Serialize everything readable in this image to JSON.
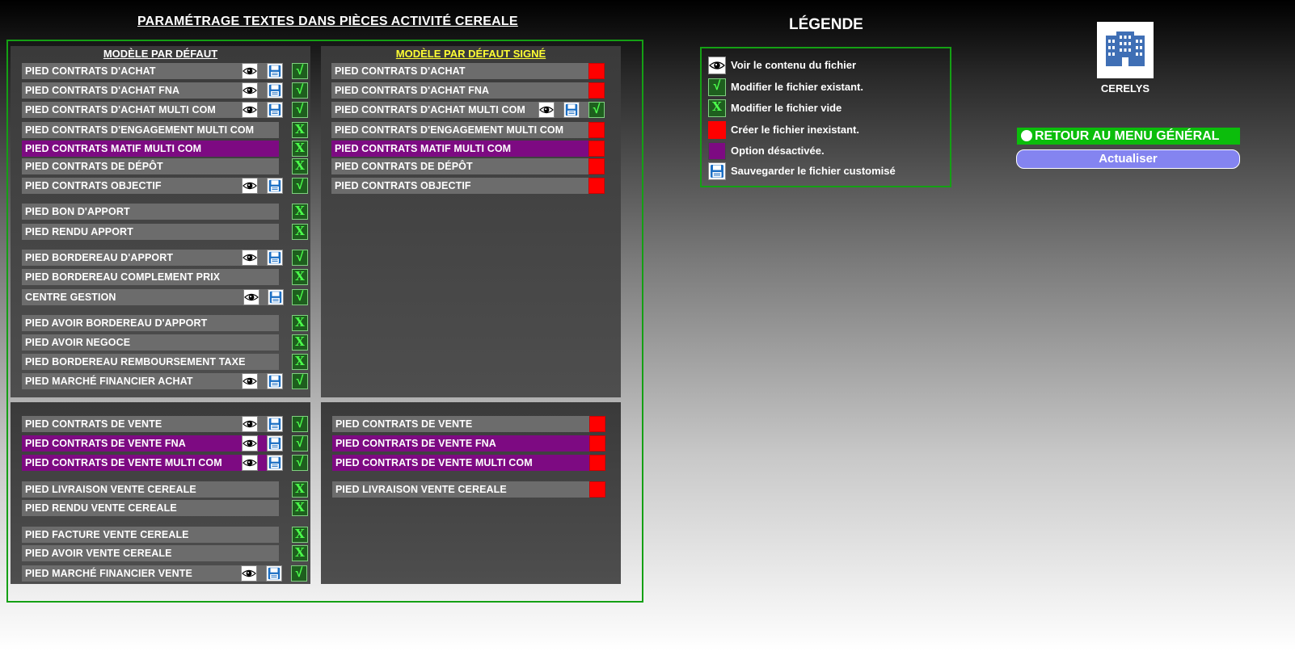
{
  "page_title": "PARAMÉTRAGE TEXTES DANS PIÈCES ACTIVITÉ CEREALE",
  "panels": {
    "default_title": "MODÈLE PAR DÉFAUT",
    "signed_title": "MODÈLE PAR DÉFAUT SIGNÉ"
  },
  "rows": {
    "r1": "PIED CONTRATS D'ACHAT",
    "r2": "PIED CONTRATS D'ACHAT FNA",
    "r3": "PIED CONTRATS D'ACHAT MULTI COM",
    "r4": "PIED CONTRATS D'ENGAGEMENT MULTI COM",
    "r5": "PIED CONTRATS MATIF MULTI COM",
    "r6": "PIED CONTRATS DE DÉPÔT",
    "r7": "PIED CONTRATS OBJECTIF",
    "r8": "PIED BON D'APPORT",
    "r9": "PIED RENDU APPORT",
    "r10": "PIED BORDEREAU D'APPORT",
    "r11": "PIED BORDEREAU COMPLEMENT PRIX",
    "r12": "CENTRE GESTION",
    "r13": "PIED AVOIR BORDEREAU D'APPORT",
    "r14": "PIED AVOIR NEGOCE",
    "r15": "PIED BORDEREAU REMBOURSEMENT TAXE",
    "r16": "PIED MARCHÉ FINANCIER ACHAT",
    "v1": "PIED CONTRATS DE VENTE",
    "v2": "PIED CONTRATS DE VENTE FNA",
    "v3": "PIED CONTRATS DE VENTE MULTI COM",
    "v4": "PIED LIVRAISON VENTE CEREALE",
    "v5": "PIED RENDU VENTE CEREALE",
    "v6": "PIED FACTURE VENTE CEREALE",
    "v7": "PIED AVOIR VENTE CEREALE",
    "v8": "PIED MARCHÉ FINANCIER VENTE"
  },
  "glyphs": {
    "check": "√",
    "x": "X"
  },
  "legend": {
    "title": "LÉGENDE",
    "view": "Voir le contenu du fichier",
    "modify_existing": "Modifier le fichier existant.",
    "modify_empty": "Modifier le fichier vide",
    "create": "Créer le fichier inexistant.",
    "disabled": "Option désactivée.",
    "save": "Sauvegarder le fichier customisé"
  },
  "app": {
    "name": "CERELYS"
  },
  "buttons": {
    "menu": "RETOUR AU MENU GÉNÉRAL",
    "refresh": "Actualiser"
  },
  "colors": {
    "frame": "#14a014",
    "purple": "#7d0a82",
    "red": "#ff0000",
    "green_btn": "#0bbd0b",
    "refresh_btn": "#8484f0",
    "signed_title": "#ffff33"
  }
}
